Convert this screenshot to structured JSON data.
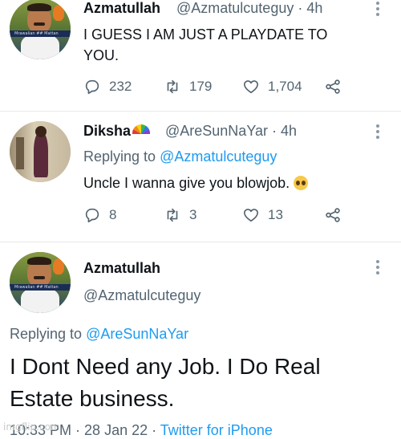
{
  "tweet1": {
    "name": "Azmatullah",
    "handle": "@Azmatulcuteguy · 4h",
    "text_line1": "I GUESS I AM JUST A PLAYDATE TO",
    "text_line2": "YOU.",
    "replies": "232",
    "retweets": "179",
    "likes": "1,704"
  },
  "tweet2": {
    "name": "Diksha",
    "handle": "@AreSunNaYar · 4h",
    "replying_prefix": "Replying to ",
    "replying_to": "@Azmatulcuteguy",
    "text": "Uncle I wanna give you blowjob.",
    "replies": "8",
    "retweets": "3",
    "likes": "13"
  },
  "tweet3": {
    "name": "Azmatullah",
    "handle": "@Azmatulcuteguy",
    "replying_prefix": "Replying to ",
    "replying_to": "@AreSunNaYar",
    "text_line1": "I Dont Need any Job. I Do Real",
    "text_line2": "Estate business.",
    "time": "10:33 PM · 28 Jan 22 · ",
    "source": "Twitter for iPhone"
  },
  "avatar_band_text": "Mrawalian ## Mattan",
  "watermark": "imgflip.com",
  "colors": {
    "link": "#1d9bf0",
    "muted": "#536471",
    "text": "#0f1419"
  },
  "icons": [
    "reply-icon",
    "retweet-icon",
    "like-icon",
    "share-icon",
    "more-icon"
  ]
}
